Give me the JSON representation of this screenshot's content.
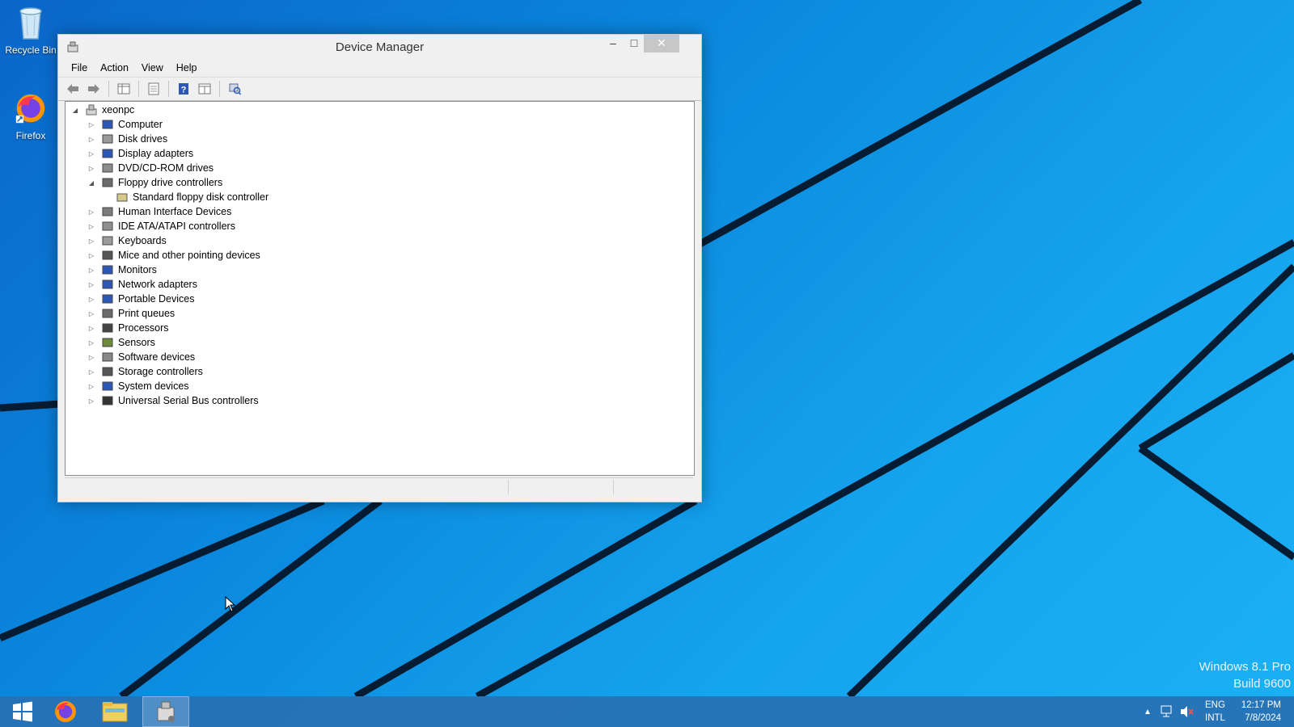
{
  "desktop": {
    "icons": [
      {
        "label": "Recycle Bin",
        "icon": "recycle-bin-icon"
      },
      {
        "label": "Firefox",
        "icon": "firefox-icon"
      }
    ],
    "watermark": {
      "line1": "Windows 8.1 Pro",
      "line2": "Build 9600"
    }
  },
  "window": {
    "title": "Device Manager",
    "menu": [
      "File",
      "Action",
      "View",
      "Help"
    ],
    "toolbar_icons": [
      "back-arrow-icon",
      "forward-arrow-icon",
      "console-tree-icon",
      "properties-icon",
      "help-icon",
      "view-icon",
      "scan-hardware-icon"
    ],
    "tree": {
      "root": "xeonpc",
      "categories": [
        {
          "label": "Computer",
          "expanded": false
        },
        {
          "label": "Disk drives",
          "expanded": false
        },
        {
          "label": "Display adapters",
          "expanded": false
        },
        {
          "label": "DVD/CD-ROM drives",
          "expanded": false
        },
        {
          "label": "Floppy drive controllers",
          "expanded": true,
          "children": [
            "Standard floppy disk controller"
          ]
        },
        {
          "label": "Human Interface Devices",
          "expanded": false
        },
        {
          "label": "IDE ATA/ATAPI controllers",
          "expanded": false
        },
        {
          "label": "Keyboards",
          "expanded": false
        },
        {
          "label": "Mice and other pointing devices",
          "expanded": false
        },
        {
          "label": "Monitors",
          "expanded": false
        },
        {
          "label": "Network adapters",
          "expanded": false
        },
        {
          "label": "Portable Devices",
          "expanded": false
        },
        {
          "label": "Print queues",
          "expanded": false
        },
        {
          "label": "Processors",
          "expanded": false
        },
        {
          "label": "Sensors",
          "expanded": false
        },
        {
          "label": "Software devices",
          "expanded": false
        },
        {
          "label": "Storage controllers",
          "expanded": false
        },
        {
          "label": "System devices",
          "expanded": false
        },
        {
          "label": "Universal Serial Bus controllers",
          "expanded": false
        }
      ]
    }
  },
  "taskbar": {
    "items": [
      "start-icon",
      "firefox-icon",
      "file-explorer-icon",
      "device-manager-icon"
    ],
    "tray": {
      "language_line1": "ENG",
      "language_line2": "INTL",
      "time": "12:17 PM",
      "date": "7/8/2024"
    }
  },
  "colors": {
    "desktop_blue": "#0a86dc",
    "taskbar": "#2870b4",
    "window_bg": "#f0f0f0"
  }
}
